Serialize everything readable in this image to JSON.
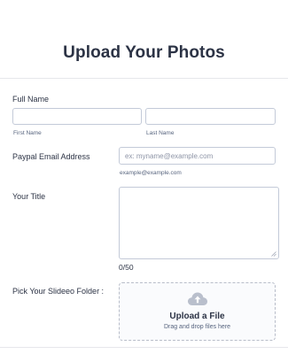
{
  "form": {
    "title": "Upload Your Photos"
  },
  "full_name": {
    "label": "Full Name",
    "first_sublabel": "First Name",
    "last_sublabel": "Last Name",
    "first_value": "",
    "last_value": ""
  },
  "email": {
    "label": "Paypal Email Address",
    "placeholder": "ex: myname@example.com",
    "sublabel": "example@example.com"
  },
  "title_field": {
    "label": "Your Title",
    "value": "",
    "counter": "0/50"
  },
  "folder": {
    "label": "Pick Your Slideeo Folder :",
    "upload_title": "Upload a File",
    "upload_sub": "Drag and drop files here",
    "icon": "cloud-upload-icon"
  },
  "colors": {
    "text": "#2c3345",
    "muted": "#57647e",
    "border": "#c3cad8",
    "icon": "#b9bfcc"
  }
}
